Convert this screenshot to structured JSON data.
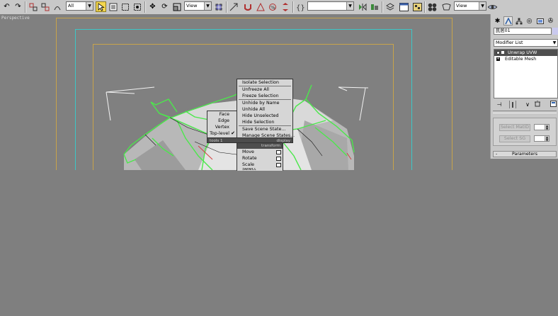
{
  "toolbar": {
    "selection_filter": "All",
    "ref_coord_system": "View",
    "named_selection_set": "",
    "render_type": "View"
  },
  "viewport": {
    "label": "Perspective"
  },
  "quad_menu": {
    "tools_head_right": "display",
    "tools_head_left": "tools 1",
    "display_items": [
      "Isolate Selection",
      "Unfreeze All",
      "Freeze Selection",
      "Unhide by Name",
      "Unhide All",
      "Hide Unselected",
      "Hide Selection",
      "Save Scene State...",
      "Manage Scene States..."
    ],
    "subobject_items": [
      "Face",
      "Edge",
      "Vertex",
      "Top-level"
    ],
    "transform_head": "transform",
    "transform_items": [
      "Move",
      "Rotate",
      "Scale",
      "Select"
    ],
    "checked_item": "Top-level"
  },
  "command_panel": {
    "object_name": "民居01",
    "object_color": "#c9c9ee",
    "modifier_list_label": "Modifier List",
    "stack": [
      {
        "label": "Unwrap UVW",
        "selected": true
      },
      {
        "label": "Editable Mesh",
        "selected": false
      }
    ],
    "select_matid_label": "Select MatID",
    "select_sg_label": "Select SG",
    "parameters_label": "Parameters",
    "rollout_collapse_symbol": "-"
  },
  "colors": {
    "selection_wire": "#4be84b",
    "safe_frame_outer": "#c9a44a",
    "safe_frame_action": "#3cc7c7",
    "active_button": "#f3d64e",
    "stack_selected": "#4f4f4f"
  }
}
